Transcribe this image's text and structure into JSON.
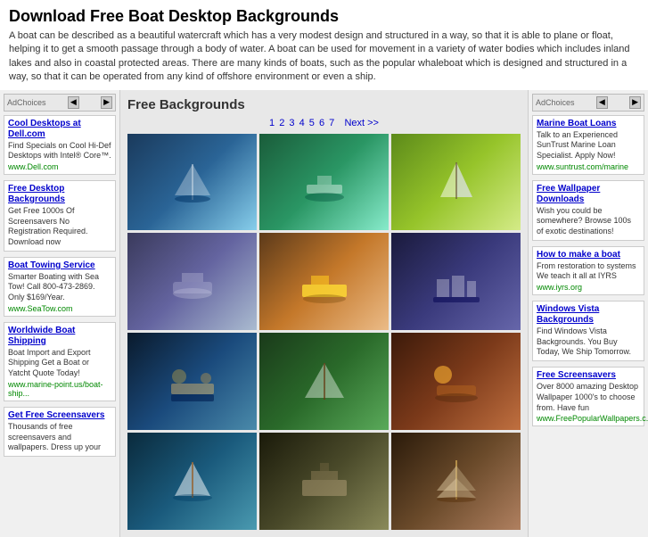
{
  "header": {
    "title": "Download Free Boat Desktop Backgrounds",
    "description": "A boat can be described as a beautiful watercraft which has a very modest design and structured in a way, so that it is able to plane or float, helping it to get a smooth passage through a body of water. A boat can be used for movement in a variety of water bodies which includes inland lakes and also in coastal protected areas. There are many kinds of boats, such as the popular whaleboat which is designed and structured in a way, so that it can be operated from any kind of offshore environment or even a ship."
  },
  "left_sidebar": {
    "adchoices_label": "AdChoices",
    "ads": [
      {
        "title": "Cool Desktops at Dell.com",
        "desc": "Find Specials on Cool Hi-Def Desktops with Intel® Core™.",
        "url": "www.Dell.com"
      },
      {
        "title": "Free Desktop Backgrounds",
        "desc": "Get Free 1000s Of Screensavers No Registration Required. Download now",
        "url": ""
      },
      {
        "title": "Boat Towing Service",
        "desc": "Smarter Boating with Sea Tow! Call 800-473-2869. Only $169/Year.",
        "url": "www.SeaTow.com"
      },
      {
        "title": "Worldwide Boat Shipping",
        "desc": "Boat Import and Export Shipping Get a Boat or Yatcht Quote Today!",
        "url": "www.marine-point.us/boat-ship..."
      },
      {
        "title": "Get Free Screensavers",
        "desc": "Thousands of free screensavers and wallpapers. Dress up your",
        "url": ""
      }
    ]
  },
  "center": {
    "section_title": "Free Backgrounds",
    "pagination": {
      "pages": [
        "1",
        "2",
        "3",
        "4",
        "5",
        "6",
        "7"
      ],
      "current": "1",
      "next_label": "Next >>"
    },
    "images": [
      {
        "id": 1,
        "alt": "Sailboat 1"
      },
      {
        "id": 2,
        "alt": "Tropical boat"
      },
      {
        "id": 3,
        "alt": "Sailboat 2"
      },
      {
        "id": 4,
        "alt": "Harbor boat"
      },
      {
        "id": 5,
        "alt": "Yellow boat"
      },
      {
        "id": 6,
        "alt": "Marina boats"
      },
      {
        "id": 7,
        "alt": "Night city boat"
      },
      {
        "id": 8,
        "alt": "Green water boat"
      },
      {
        "id": 9,
        "alt": "Sunset boat"
      },
      {
        "id": 10,
        "alt": "Ocean boat"
      },
      {
        "id": 11,
        "alt": "Ship silhouette"
      },
      {
        "id": 12,
        "alt": "Tall ship"
      }
    ]
  },
  "right_sidebar": {
    "adchoices_label": "AdChoices",
    "ads": [
      {
        "title": "Marine Boat Loans",
        "desc": "Talk to an Experienced SunTrust Marine Loan Specialist. Apply Now!",
        "url": "www.suntrust.com/marine"
      },
      {
        "title": "Free Wallpaper Downloads",
        "desc": "Wish you could be somewhere? Browse 100s of exotic destinations!",
        "url": ""
      },
      {
        "title": "How to make a boat",
        "desc": "From restoration to systems We teach it all at IYRS",
        "url": "www.iyrs.org"
      },
      {
        "title": "Windows Vista Backgrounds",
        "desc": "Find Windows Vista Backgrounds. You Buy Today, We Ship Tomorrow.",
        "url": ""
      },
      {
        "title": "Free Screensavers",
        "desc": "Over 8000 amazing Desktop Wallpaper 1000's to choose from. Have fun",
        "url": "www.FreePopularWallpapers.c..."
      }
    ]
  }
}
